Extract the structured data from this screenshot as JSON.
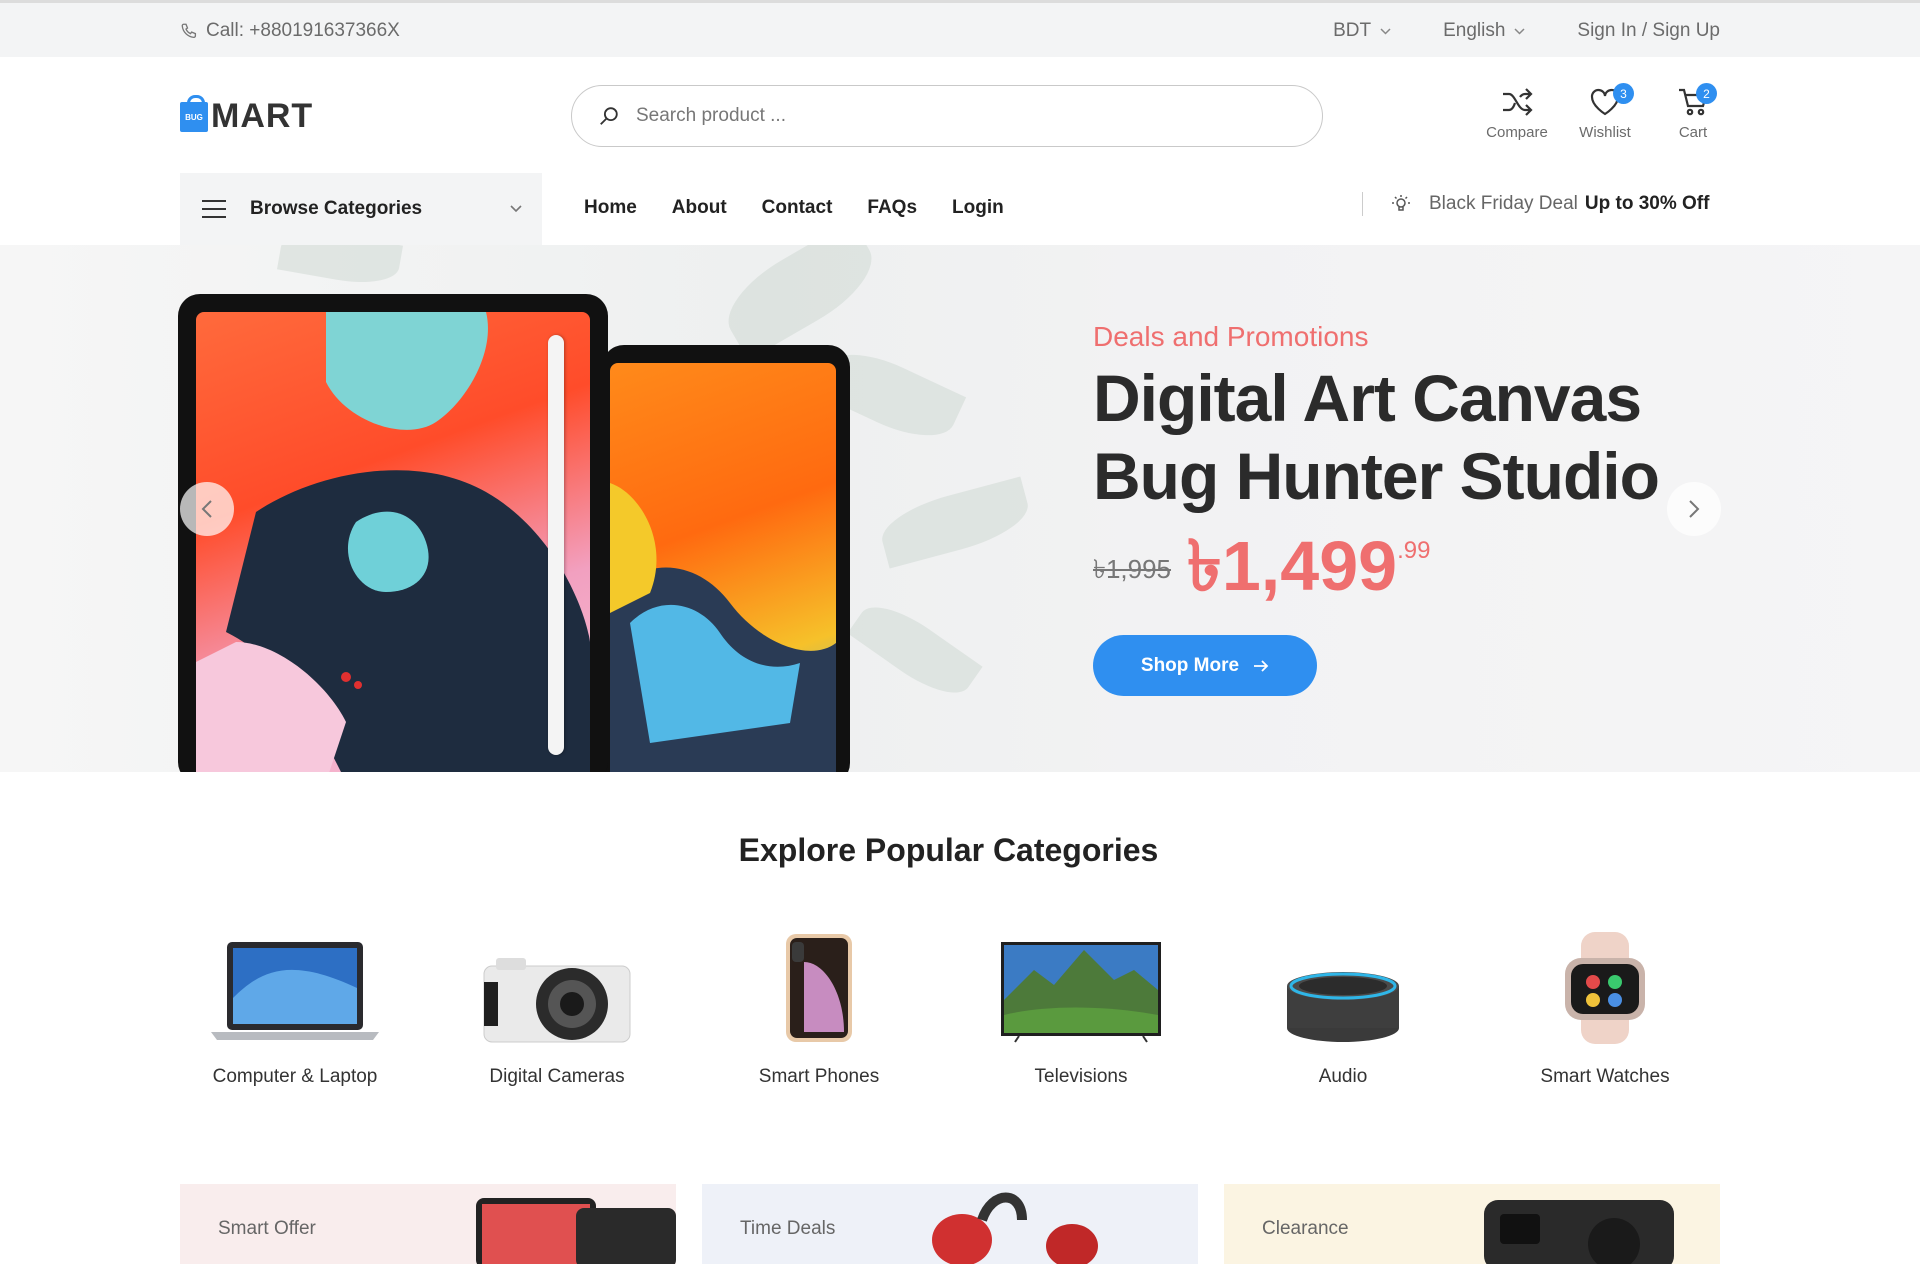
{
  "topbar": {
    "phone": "Call: +880191637366X",
    "currency": "BDT",
    "language": "English",
    "auth": "Sign In / Sign Up"
  },
  "header": {
    "logo_badge": "BUG",
    "logo_text": "MART",
    "search_placeholder": "Search product ...",
    "compare_label": "Compare",
    "wishlist_label": "Wishlist",
    "wishlist_count": "3",
    "cart_label": "Cart",
    "cart_count": "2",
    "accent": "#2f8ff0"
  },
  "nav": {
    "browse_label": "Browse Categories",
    "menu": [
      "Home",
      "About",
      "Contact",
      "FAQs",
      "Login"
    ],
    "deal_text": "Black Friday Deal",
    "deal_bold": "Up to 30% Off"
  },
  "hero": {
    "kicker": "Deals and Promotions",
    "title_line1": "Digital Art Canvas",
    "title_line2": "Bug Hunter Studio",
    "old_price": "৳1,995",
    "new_price": "৳1,499",
    "cents": ".99",
    "cta": "Shop More",
    "price_color": "#ef6f6f"
  },
  "categories": {
    "title": "Explore Popular Categories",
    "items": [
      {
        "name": "Computer & Laptop",
        "icon": "laptop-icon"
      },
      {
        "name": "Digital Cameras",
        "icon": "camera-icon"
      },
      {
        "name": "Smart Phones",
        "icon": "phone-icon"
      },
      {
        "name": "Televisions",
        "icon": "tv-icon"
      },
      {
        "name": "Audio",
        "icon": "speaker-icon"
      },
      {
        "name": "Smart Watches",
        "icon": "watch-icon"
      }
    ]
  },
  "promos": [
    {
      "label": "Smart Offer",
      "bg": "#f9eded"
    },
    {
      "label": "Time Deals",
      "bg": "#eef1f8"
    },
    {
      "label": "Clearance",
      "bg": "#fbf4e2"
    }
  ]
}
